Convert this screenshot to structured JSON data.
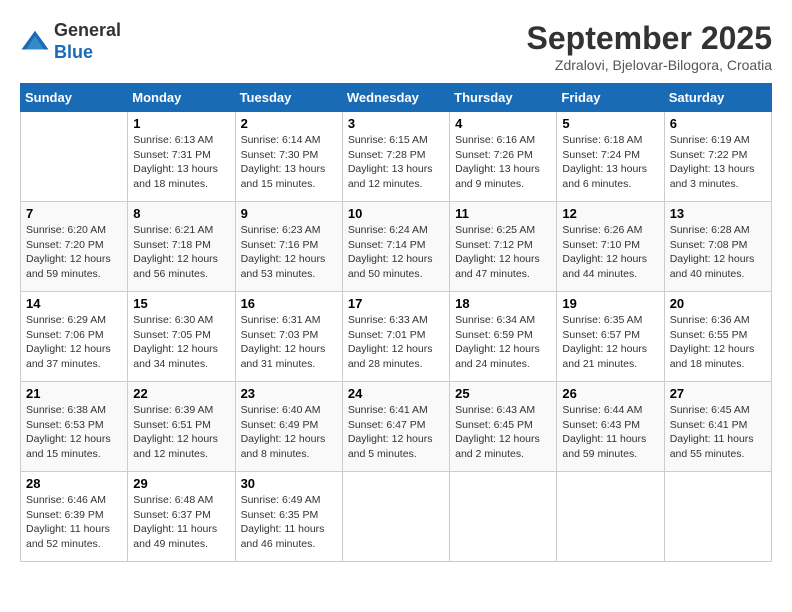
{
  "header": {
    "logo_line1": "General",
    "logo_line2": "Blue",
    "month_title": "September 2025",
    "subtitle": "Zdralovi, Bjelovar-Bilogora, Croatia"
  },
  "weekdays": [
    "Sunday",
    "Monday",
    "Tuesday",
    "Wednesday",
    "Thursday",
    "Friday",
    "Saturday"
  ],
  "weeks": [
    [
      {
        "day": "",
        "sunrise": "",
        "sunset": "",
        "daylight": ""
      },
      {
        "day": "1",
        "sunrise": "Sunrise: 6:13 AM",
        "sunset": "Sunset: 7:31 PM",
        "daylight": "Daylight: 13 hours and 18 minutes."
      },
      {
        "day": "2",
        "sunrise": "Sunrise: 6:14 AM",
        "sunset": "Sunset: 7:30 PM",
        "daylight": "Daylight: 13 hours and 15 minutes."
      },
      {
        "day": "3",
        "sunrise": "Sunrise: 6:15 AM",
        "sunset": "Sunset: 7:28 PM",
        "daylight": "Daylight: 13 hours and 12 minutes."
      },
      {
        "day": "4",
        "sunrise": "Sunrise: 6:16 AM",
        "sunset": "Sunset: 7:26 PM",
        "daylight": "Daylight: 13 hours and 9 minutes."
      },
      {
        "day": "5",
        "sunrise": "Sunrise: 6:18 AM",
        "sunset": "Sunset: 7:24 PM",
        "daylight": "Daylight: 13 hours and 6 minutes."
      },
      {
        "day": "6",
        "sunrise": "Sunrise: 6:19 AM",
        "sunset": "Sunset: 7:22 PM",
        "daylight": "Daylight: 13 hours and 3 minutes."
      }
    ],
    [
      {
        "day": "7",
        "sunrise": "Sunrise: 6:20 AM",
        "sunset": "Sunset: 7:20 PM",
        "daylight": "Daylight: 12 hours and 59 minutes."
      },
      {
        "day": "8",
        "sunrise": "Sunrise: 6:21 AM",
        "sunset": "Sunset: 7:18 PM",
        "daylight": "Daylight: 12 hours and 56 minutes."
      },
      {
        "day": "9",
        "sunrise": "Sunrise: 6:23 AM",
        "sunset": "Sunset: 7:16 PM",
        "daylight": "Daylight: 12 hours and 53 minutes."
      },
      {
        "day": "10",
        "sunrise": "Sunrise: 6:24 AM",
        "sunset": "Sunset: 7:14 PM",
        "daylight": "Daylight: 12 hours and 50 minutes."
      },
      {
        "day": "11",
        "sunrise": "Sunrise: 6:25 AM",
        "sunset": "Sunset: 7:12 PM",
        "daylight": "Daylight: 12 hours and 47 minutes."
      },
      {
        "day": "12",
        "sunrise": "Sunrise: 6:26 AM",
        "sunset": "Sunset: 7:10 PM",
        "daylight": "Daylight: 12 hours and 44 minutes."
      },
      {
        "day": "13",
        "sunrise": "Sunrise: 6:28 AM",
        "sunset": "Sunset: 7:08 PM",
        "daylight": "Daylight: 12 hours and 40 minutes."
      }
    ],
    [
      {
        "day": "14",
        "sunrise": "Sunrise: 6:29 AM",
        "sunset": "Sunset: 7:06 PM",
        "daylight": "Daylight: 12 hours and 37 minutes."
      },
      {
        "day": "15",
        "sunrise": "Sunrise: 6:30 AM",
        "sunset": "Sunset: 7:05 PM",
        "daylight": "Daylight: 12 hours and 34 minutes."
      },
      {
        "day": "16",
        "sunrise": "Sunrise: 6:31 AM",
        "sunset": "Sunset: 7:03 PM",
        "daylight": "Daylight: 12 hours and 31 minutes."
      },
      {
        "day": "17",
        "sunrise": "Sunrise: 6:33 AM",
        "sunset": "Sunset: 7:01 PM",
        "daylight": "Daylight: 12 hours and 28 minutes."
      },
      {
        "day": "18",
        "sunrise": "Sunrise: 6:34 AM",
        "sunset": "Sunset: 6:59 PM",
        "daylight": "Daylight: 12 hours and 24 minutes."
      },
      {
        "day": "19",
        "sunrise": "Sunrise: 6:35 AM",
        "sunset": "Sunset: 6:57 PM",
        "daylight": "Daylight: 12 hours and 21 minutes."
      },
      {
        "day": "20",
        "sunrise": "Sunrise: 6:36 AM",
        "sunset": "Sunset: 6:55 PM",
        "daylight": "Daylight: 12 hours and 18 minutes."
      }
    ],
    [
      {
        "day": "21",
        "sunrise": "Sunrise: 6:38 AM",
        "sunset": "Sunset: 6:53 PM",
        "daylight": "Daylight: 12 hours and 15 minutes."
      },
      {
        "day": "22",
        "sunrise": "Sunrise: 6:39 AM",
        "sunset": "Sunset: 6:51 PM",
        "daylight": "Daylight: 12 hours and 12 minutes."
      },
      {
        "day": "23",
        "sunrise": "Sunrise: 6:40 AM",
        "sunset": "Sunset: 6:49 PM",
        "daylight": "Daylight: 12 hours and 8 minutes."
      },
      {
        "day": "24",
        "sunrise": "Sunrise: 6:41 AM",
        "sunset": "Sunset: 6:47 PM",
        "daylight": "Daylight: 12 hours and 5 minutes."
      },
      {
        "day": "25",
        "sunrise": "Sunrise: 6:43 AM",
        "sunset": "Sunset: 6:45 PM",
        "daylight": "Daylight: 12 hours and 2 minutes."
      },
      {
        "day": "26",
        "sunrise": "Sunrise: 6:44 AM",
        "sunset": "Sunset: 6:43 PM",
        "daylight": "Daylight: 11 hours and 59 minutes."
      },
      {
        "day": "27",
        "sunrise": "Sunrise: 6:45 AM",
        "sunset": "Sunset: 6:41 PM",
        "daylight": "Daylight: 11 hours and 55 minutes."
      }
    ],
    [
      {
        "day": "28",
        "sunrise": "Sunrise: 6:46 AM",
        "sunset": "Sunset: 6:39 PM",
        "daylight": "Daylight: 11 hours and 52 minutes."
      },
      {
        "day": "29",
        "sunrise": "Sunrise: 6:48 AM",
        "sunset": "Sunset: 6:37 PM",
        "daylight": "Daylight: 11 hours and 49 minutes."
      },
      {
        "day": "30",
        "sunrise": "Sunrise: 6:49 AM",
        "sunset": "Sunset: 6:35 PM",
        "daylight": "Daylight: 11 hours and 46 minutes."
      },
      {
        "day": "",
        "sunrise": "",
        "sunset": "",
        "daylight": ""
      },
      {
        "day": "",
        "sunrise": "",
        "sunset": "",
        "daylight": ""
      },
      {
        "day": "",
        "sunrise": "",
        "sunset": "",
        "daylight": ""
      },
      {
        "day": "",
        "sunrise": "",
        "sunset": "",
        "daylight": ""
      }
    ]
  ]
}
